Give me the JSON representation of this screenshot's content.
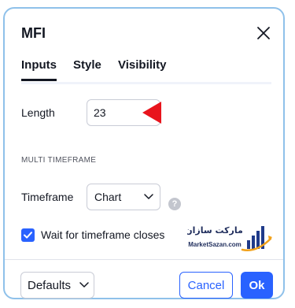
{
  "dialog": {
    "title": "MFI",
    "close_icon": "close-icon"
  },
  "tabs": [
    {
      "label": "Inputs",
      "active": true
    },
    {
      "label": "Style",
      "active": false
    },
    {
      "label": "Visibility",
      "active": false
    }
  ],
  "inputs": {
    "length_label": "Length",
    "length_value": "23",
    "section_title": "MULTI TIMEFRAME",
    "timeframe_label": "Timeframe",
    "timeframe_value": "Chart",
    "help_icon": "?",
    "wait_checkbox_checked": true,
    "wait_checkbox_label": "Wait for timeframe closes"
  },
  "watermark": {
    "name_fa": "مارکت سازان",
    "url": "MarketSazan.com"
  },
  "footer": {
    "defaults_label": "Defaults",
    "cancel_label": "Cancel",
    "ok_label": "Ok"
  },
  "colors": {
    "accent": "#2962ff",
    "annotation_arrow": "#e8141c",
    "dialog_border": "#8fc1ea"
  }
}
